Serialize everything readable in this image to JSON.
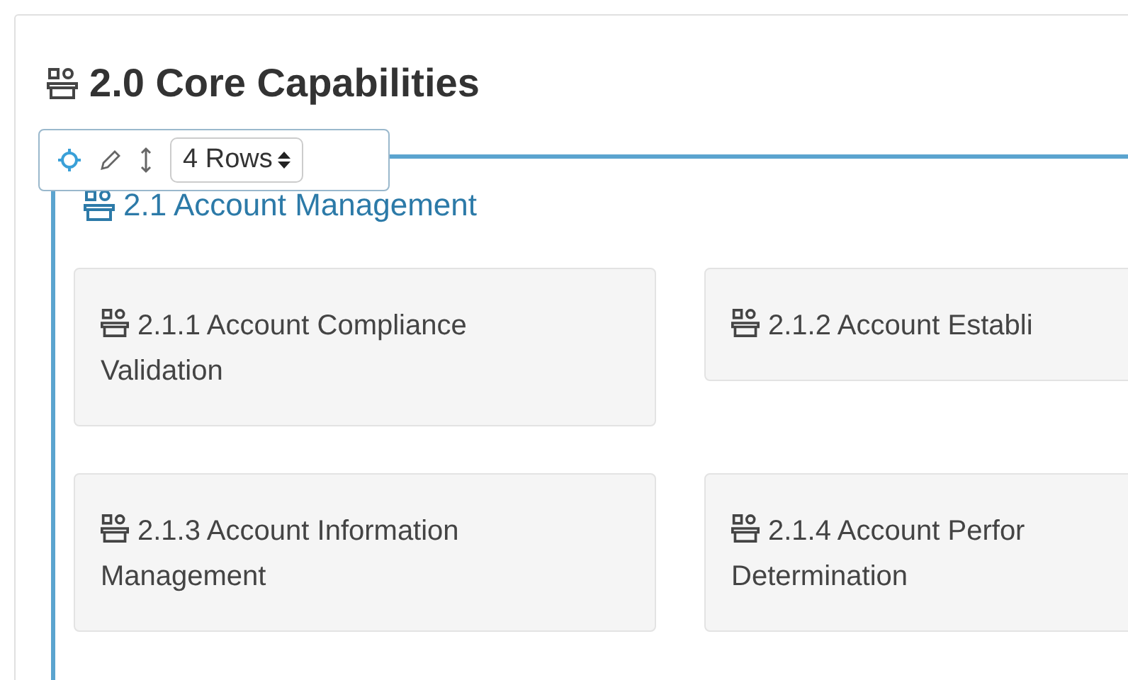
{
  "section": {
    "title": "2.0 Core Capabilities"
  },
  "toolbar": {
    "rows_select": "4 Rows"
  },
  "group": {
    "title": "2.1 Account Management",
    "cards": [
      {
        "lines": [
          "2.1.1 Account Compliance",
          "Validation"
        ]
      },
      {
        "lines": [
          "2.1.2 Account Establi"
        ]
      },
      {
        "lines": [
          "2.1.3 Account Information",
          "Management"
        ]
      },
      {
        "lines": [
          "2.1.4 Account Perfor",
          "Determination"
        ]
      }
    ]
  }
}
